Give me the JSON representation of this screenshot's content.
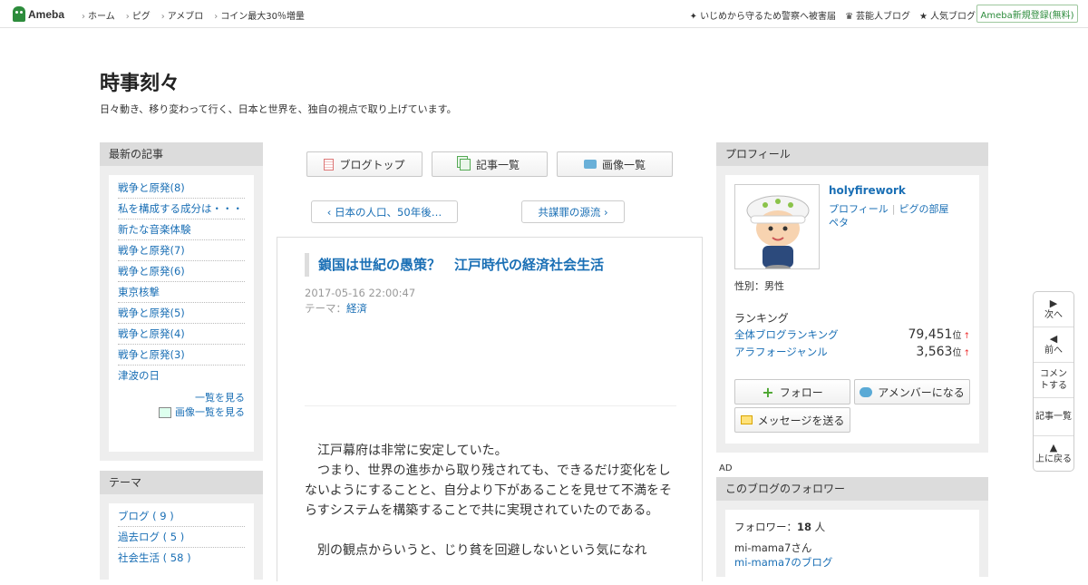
{
  "header": {
    "logo": "Ameba",
    "nav_left": [
      "ホーム",
      "ピグ",
      "アメブロ",
      "コイン最大30％増量"
    ],
    "nav_right": [
      "いじめから守るため警察へ被害届",
      "芸能人ブログ",
      "人気ブログ"
    ],
    "signup": "Ameba新規登録(無料)"
  },
  "blog": {
    "title": "時事刻々",
    "description": "日々動き、移り変わって行く、日本と世界を、独自の視点で取り上げています。"
  },
  "latest": {
    "heading": "最新の記事",
    "items": [
      "戦争と原発(8)",
      "私を構成する成分は・・・",
      "新たな音楽体験",
      "戦争と原発(7)",
      "戦争と原発(6)",
      "東京核撃",
      "戦争と原発(5)",
      "戦争と原発(4)",
      "戦争と原発(3)",
      "津波の日"
    ],
    "more_list": "一覧を見る",
    "more_images": "画像一覧を見る"
  },
  "themes": {
    "heading": "テーマ",
    "items": [
      "ブログ ( 9 )",
      "過去ログ ( 5 )",
      "社会生活 ( 58 )"
    ]
  },
  "tabs": [
    "ブログトップ",
    "記事一覧",
    "画像一覧"
  ],
  "pager": {
    "prev": "日本の人口、50年後…",
    "next": "共謀罪の源流"
  },
  "article": {
    "title": "鎖国は世紀の愚策？　江戸時代の経済社会生活",
    "date": "2017-05-16 22:00:47",
    "theme_label": "テーマ：",
    "theme": "経済",
    "paragraphs": [
      "江戸幕府は非常に安定していた。",
      "つまり、世界の進歩から取り残されても、できるだけ変化をしないようにすることと、自分より下があることを見せて不満をそらすシステムを構築することで共に実現されていたのである。",
      "",
      "別の観点からいうと、じり貧を回避しないという気になれ"
    ]
  },
  "profile": {
    "heading": "プロフィール",
    "name": "holyfirework",
    "link_profile": "プロフィール",
    "link_room": "ピグの部屋",
    "link_peta": "ペタ",
    "gender": "性別：男性",
    "ranking_heading": "ランキング",
    "ranks": [
      {
        "label": "全体ブログランキング",
        "value": "79,451",
        "unit": "位",
        "arrow": "↑"
      },
      {
        "label": "アラフォージャンル",
        "value": "3,563",
        "unit": "位",
        "arrow": "↑"
      }
    ],
    "btn_follow": "フォロー",
    "btn_member": "アメンバーになる",
    "btn_message": "メッセージを送る"
  },
  "ad_label": "AD",
  "followers": {
    "heading": "このブログのフォロワー",
    "count_label": "フォロワー：",
    "count": "18",
    "count_unit": "人",
    "user": "mi-mama7さん",
    "user_blog": "mi-mama7のブログ"
  },
  "sidenav": {
    "next": "次へ",
    "prev": "前へ",
    "comment": "コメントする",
    "list": "記事一覧",
    "top": "上に戻る"
  },
  "colors": {
    "link": "#1a6fb5",
    "brand": "#2d8c3c",
    "panel": "#eeeeee"
  }
}
